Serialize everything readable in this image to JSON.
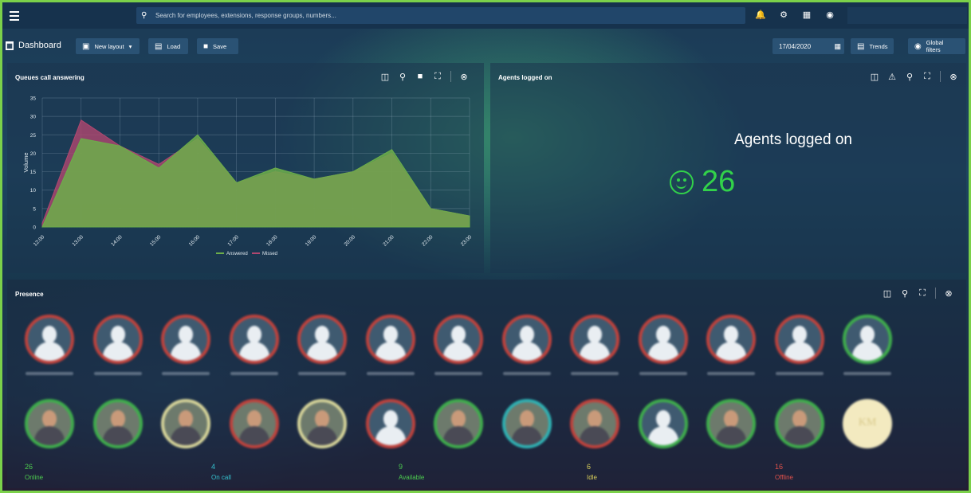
{
  "topbar": {
    "search_placeholder": "Search for employees, extensions, response groups, numbers...",
    "icons": [
      "menu-icon",
      "bell-icon",
      "gear-icon",
      "apps-icon",
      "palette-icon"
    ]
  },
  "toolbar": {
    "title": "Dashboard",
    "new_layout": "New layout",
    "load": "Load",
    "save": "Save",
    "date": "17/04/2020",
    "trends": "Trends",
    "global_filters": "Global filters"
  },
  "queues_panel": {
    "title": "Queues call answering"
  },
  "agents_panel": {
    "title": "Agents logged on",
    "big_label": "Agents logged on",
    "value": "26"
  },
  "presence_panel": {
    "title": "Presence",
    "row1_status_colors": [
      "#c0423c",
      "#c0423c",
      "#c0423c",
      "#c0423c",
      "#c0423c",
      "#c0423c",
      "#c0423c",
      "#c0423c",
      "#c0423c",
      "#c0423c",
      "#c0423c",
      "#c0423c",
      "#3fae4c"
    ],
    "row2_status_colors": [
      "#3fae4c",
      "#3fae4c",
      "#d7d59a",
      "#c0423c",
      "#d7d59a",
      "#c0423c",
      "#3fae4c",
      "#2fb1b3",
      "#c0423c",
      "#3fae4c",
      "#3fae4c",
      "#3fae4c",
      "#f3eac0"
    ],
    "row2_initials": "KM",
    "stats": [
      {
        "value": "26",
        "label": "Online",
        "color": "#4ccb4f"
      },
      {
        "value": "4",
        "label": "On call",
        "color": "#35c2cf"
      },
      {
        "value": "9",
        "label": "Available",
        "color": "#4ccb4f"
      },
      {
        "value": "6",
        "label": "Idle",
        "color": "#d9cf5a"
      },
      {
        "value": "16",
        "label": "Offline",
        "color": "#e0514b"
      }
    ]
  },
  "chart_data": {
    "type": "area",
    "x": [
      "12:00",
      "13:00",
      "14:00",
      "15:00",
      "16:00",
      "17:00",
      "18:00",
      "19:00",
      "20:00",
      "21:00",
      "22:00",
      "23:00"
    ],
    "series": [
      {
        "name": "Answered",
        "color": "#6cae4a",
        "values": [
          0,
          24,
          22,
          16,
          25,
          12,
          16,
          13,
          15,
          21,
          5,
          3
        ]
      },
      {
        "name": "Missed",
        "color": "#b0476f",
        "values": [
          1,
          29,
          22,
          17,
          24,
          12,
          15,
          13,
          15,
          20,
          5,
          3
        ]
      }
    ],
    "ylabel": "Volume",
    "ylim": [
      0,
      35
    ],
    "yticks": [
      0,
      5,
      10,
      15,
      20,
      25,
      30,
      35
    ],
    "grid": true,
    "legend": "bottom"
  }
}
